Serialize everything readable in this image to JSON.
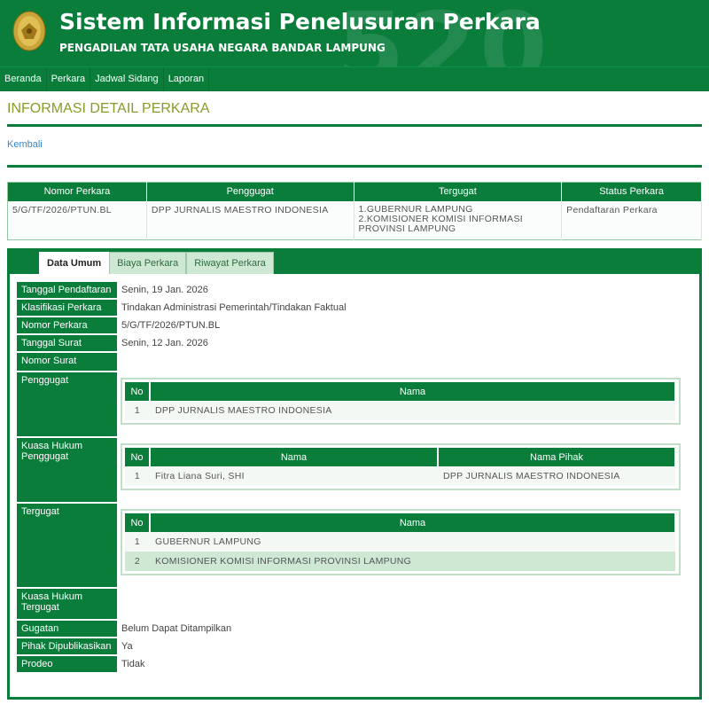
{
  "header": {
    "title": "Sistem Informasi Penelusuran Perkara",
    "subtitle": "PENGADILAN TATA USAHA NEGARA BANDAR LAMPUNG"
  },
  "nav": {
    "items": [
      "Beranda",
      "Perkara",
      "Jadwal Sidang",
      "Laporan"
    ]
  },
  "page": {
    "title": "INFORMASI DETAIL PERKARA",
    "back_label": "Kembali"
  },
  "summary": {
    "headers": [
      "Nomor Perkara",
      "Penggugat",
      "Tergugat",
      "Status Perkara"
    ],
    "nomor": "5/G/TF/2026/PTUN.BL",
    "penggugat": "DPP JURNALIS MAESTRO INDONESIA",
    "tergugat": [
      "1.GUBERNUR LAMPUNG",
      "2.KOMISIONER KOMISI INFORMASI PROVINSI LAMPUNG"
    ],
    "status": "Pendaftaran Perkara"
  },
  "tabs": [
    "Data Umum",
    "Biaya Perkara",
    "Riwayat Perkara"
  ],
  "detail": {
    "labels": {
      "tanggal_pendaftaran": "Tanggal Pendaftaran",
      "klasifikasi": "Klasifikasi Perkara",
      "nomor_perkara": "Nomor Perkara",
      "tanggal_surat": "Tanggal Surat",
      "nomor_surat": "Nomor Surat",
      "penggugat": "Penggugat",
      "kuasa_penggugat": "Kuasa Hukum Penggugat",
      "tergugat": "Tergugat",
      "kuasa_tergugat": "Kuasa Hukum Tergugat",
      "gugatan": "Gugatan",
      "pihak_dipublikasikan": "Pihak Dipublikasikan",
      "prodeo": "Prodeo"
    },
    "values": {
      "tanggal_pendaftaran": "Senin, 19 Jan. 2026",
      "klasifikasi": "Tindakan Administrasi Pemerintah/Tindakan Faktual",
      "nomor_perkara": "5/G/TF/2026/PTUN.BL",
      "tanggal_surat": "Senin, 12 Jan. 2026",
      "nomor_surat": "",
      "gugatan": "Belum Dapat Ditampilkan",
      "pihak_dipublikasikan": "Ya",
      "prodeo": "Tidak"
    },
    "penggugat_table": {
      "headers": [
        "No",
        "Nama"
      ],
      "rows": [
        [
          "1",
          "DPP JURNALIS MAESTRO INDONESIA"
        ]
      ]
    },
    "kuasa_penggugat_table": {
      "headers": [
        "No",
        "Nama",
        "Nama Pihak"
      ],
      "rows": [
        [
          "1",
          "Fitra Liana Suri, SHI",
          "DPP JURNALIS MAESTRO INDONESIA"
        ]
      ]
    },
    "tergugat_table": {
      "headers": [
        "No",
        "Nama"
      ],
      "rows": [
        [
          "1",
          "GUBERNUR LAMPUNG"
        ],
        [
          "2",
          "KOMISIONER KOMISI INFORMASI PROVINSI LAMPUNG"
        ]
      ]
    }
  },
  "colors": {
    "primary_green": "#0a7d3b",
    "title_olive": "#8a9a2a",
    "link_blue": "#3a86c8",
    "light_green": "#cfe8d4"
  }
}
